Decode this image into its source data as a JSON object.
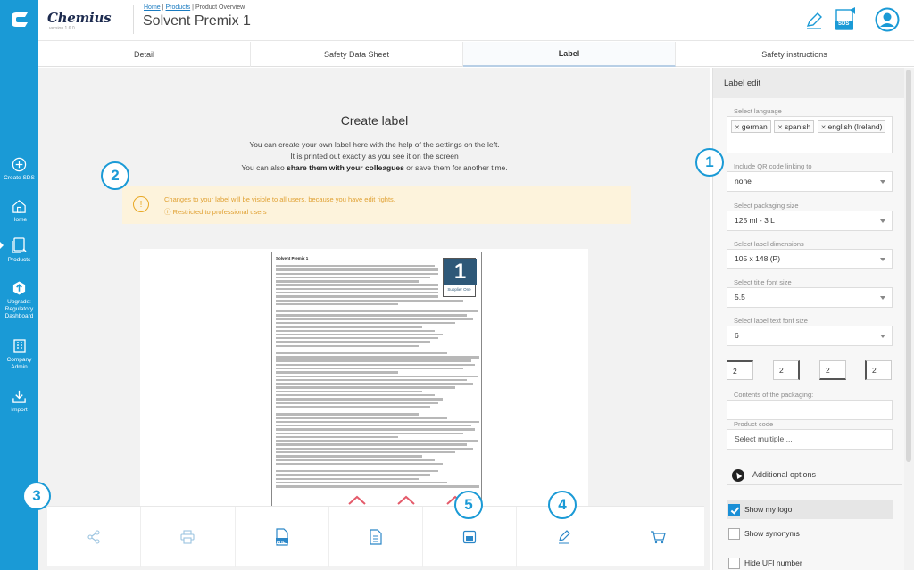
{
  "app": {
    "brand": "Chemius",
    "version": "version 1.6.0",
    "page_title": "Solvent Premix 1",
    "breadcrumbs": [
      "Home",
      "Products",
      "Product Overview"
    ]
  },
  "rail": {
    "items": [
      {
        "label": "Create SDS",
        "icon": "plus-circle-icon"
      },
      {
        "label": "Home",
        "icon": "home-icon"
      },
      {
        "label": "Products",
        "icon": "products-icon"
      },
      {
        "label": "Upgrade: Regulatory Dashboard",
        "icon": "upgrade-icon"
      },
      {
        "label": "Company Admin",
        "icon": "company-icon"
      },
      {
        "label": "Import",
        "icon": "import-icon"
      }
    ]
  },
  "header_icons": [
    "edit-icon",
    "sds-icon",
    "user-avatar-icon"
  ],
  "header_sds_badge": "SDS",
  "tabs": [
    {
      "label": "Detail",
      "active": false
    },
    {
      "label": "Safety Data Sheet",
      "active": false
    },
    {
      "label": "Label",
      "active": true
    },
    {
      "label": "Safety instructions",
      "active": false
    }
  ],
  "main": {
    "title": "Create label",
    "desc_line1": "You can create your own label here with the help of the settings on the left.",
    "desc_line2": "It is printed out exactly as you see it on the screen",
    "desc_line3_pre": "You can also ",
    "desc_line3_bold": "share them with your colleagues",
    "desc_line3_post": " or save them for another time.",
    "alert_line1": "Changes to your label will be visible to all users, because you have edit rights.",
    "alert_line2": "ⓘ Restricted to professional users"
  },
  "label_preview": {
    "title": "Solvent Premix 1",
    "logo_number": "1",
    "logo_name": "Supplier One"
  },
  "toolbar": [
    "share-icon",
    "print-icon",
    "pdf-icon",
    "document-icon",
    "save-icon",
    "edit-icon",
    "cart-icon"
  ],
  "toolbar_pdf_badge": "PDF",
  "markers": [
    "1",
    "2",
    "3",
    "4",
    "5"
  ],
  "side": {
    "header": "Label edit",
    "language_label": "Select language",
    "languages": [
      "german",
      "spanish",
      "english (Ireland)"
    ],
    "qr_label": "Include QR code linking to",
    "qr_value": "none",
    "pack_label": "Select packaging size",
    "pack_value": "125 ml - 3 L",
    "dim_label": "Select label dimensions",
    "dim_value": "105 x 148 (P)",
    "title_font_label": "Select title font size",
    "title_font_value": "5.5",
    "text_font_label": "Select label text font size",
    "text_font_value": "6",
    "margins": [
      "2",
      "2",
      "2",
      "2"
    ],
    "contents_label": "Contents of the packaging:",
    "contents_value": "",
    "product_code_label": "Product code",
    "product_code_placeholder": "Select multiple ...",
    "additional": "Additional options",
    "opt_logo": "Show my logo",
    "opt_synonyms": "Show synonyms",
    "opt_ufi": "Hide UFI number"
  },
  "colors": {
    "rail": "#1a9ad6",
    "accent": "#1a9ad6",
    "alert_bg": "#fdf3dc",
    "alert_text": "#e0a133",
    "logo_box": "#2e5878"
  }
}
